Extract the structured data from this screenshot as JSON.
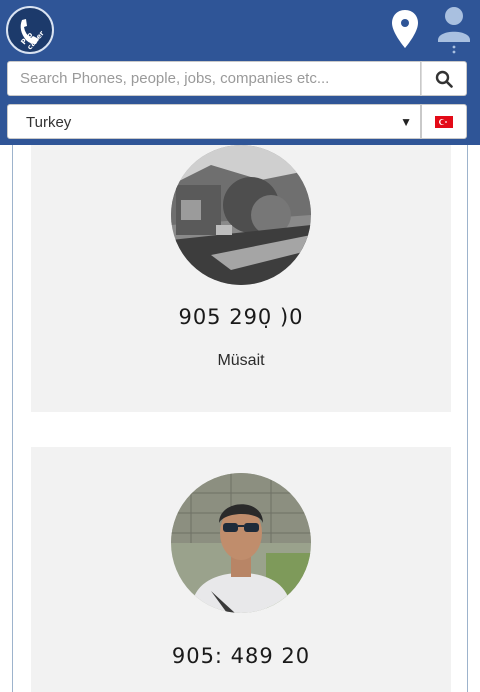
{
  "header": {
    "logo_text": "Pro caller",
    "location_icon": "location-pin-icon",
    "user_icon": "user-profile-icon"
  },
  "search": {
    "placeholder": "Search Phones, people, jobs, companies etc...",
    "value": ""
  },
  "country": {
    "selected": "Turkey",
    "caret": "▼",
    "flag": "turkey-flag-icon"
  },
  "results": [
    {
      "phone": "905   290̣   )0",
      "status": "Müsait"
    },
    {
      "phone": "905:   489    20",
      "status": ""
    }
  ],
  "colors": {
    "header_bg": "#2f5597",
    "card_bg": "#f2f2f2",
    "flag_red": "#e30a17"
  }
}
